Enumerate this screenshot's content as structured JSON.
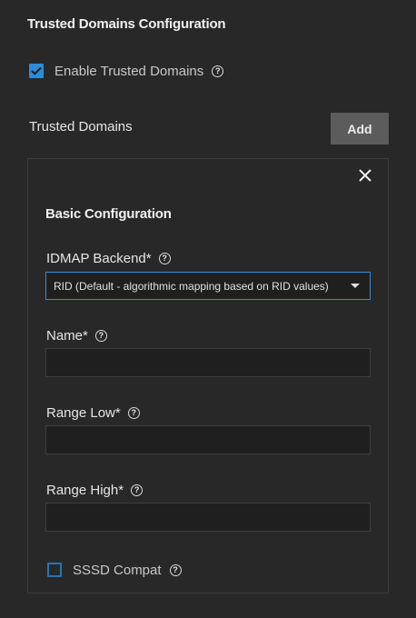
{
  "section": {
    "title": "Trusted Domains Configuration",
    "enable_label": "Enable Trusted Domains",
    "enable_checked": true
  },
  "trusted_domains": {
    "label": "Trusted Domains",
    "add_label": "Add"
  },
  "card": {
    "title": "Basic Configuration",
    "idmap_backend": {
      "label": "IDMAP Backend",
      "required": "*",
      "value": "RID (Default - algorithmic mapping based on RID values)"
    },
    "name": {
      "label": "Name",
      "required": "*",
      "value": ""
    },
    "range_low": {
      "label": "Range Low",
      "required": "*",
      "value": ""
    },
    "range_high": {
      "label": "Range High",
      "required": "*",
      "value": ""
    },
    "sssd_compat": {
      "label": "SSSD Compat",
      "checked": false
    }
  },
  "colors": {
    "background": "#282828",
    "accent": "#2b8cd8",
    "button": "#5c5c5c"
  },
  "icons": {
    "help": "help-circle-icon",
    "close": "close-icon",
    "check": "checkmark-icon",
    "dropdown": "caret-down-icon"
  }
}
